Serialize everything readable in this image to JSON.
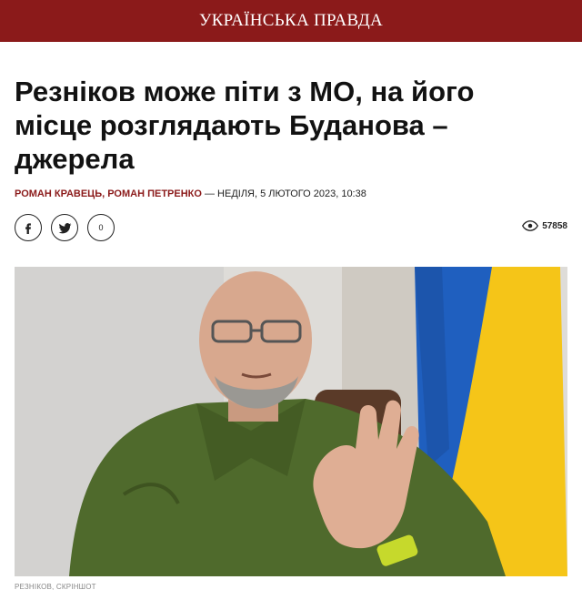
{
  "header": {
    "logo_text": "УКРАЇНСЬКА ПРАВДА",
    "background_color": "#8b1a1a"
  },
  "article": {
    "headline_line1": "Резніков може піти з МО, на його",
    "headline_line2": "місце розглядають Буданова –",
    "headline_line3": "джерела",
    "authors": "РОМАН КРАВЕЦЬ, РОМАН ПЕТРЕНКО",
    "date": "— НЕДІЛЯ, 5 ЛЮТОГО 2023, 10:38"
  },
  "share": {
    "facebook_icon": "facebook-icon",
    "twitter_icon": "twitter-icon",
    "comment_icon": "comment-icon",
    "comment_count": "0",
    "views_icon": "eye-icon",
    "views_count": "57858"
  },
  "photo": {
    "caption": "РЕЗНІКОВ, СКРІНШОТ",
    "flag_colors": [
      "#1f5fbf",
      "#f5c518"
    ]
  }
}
